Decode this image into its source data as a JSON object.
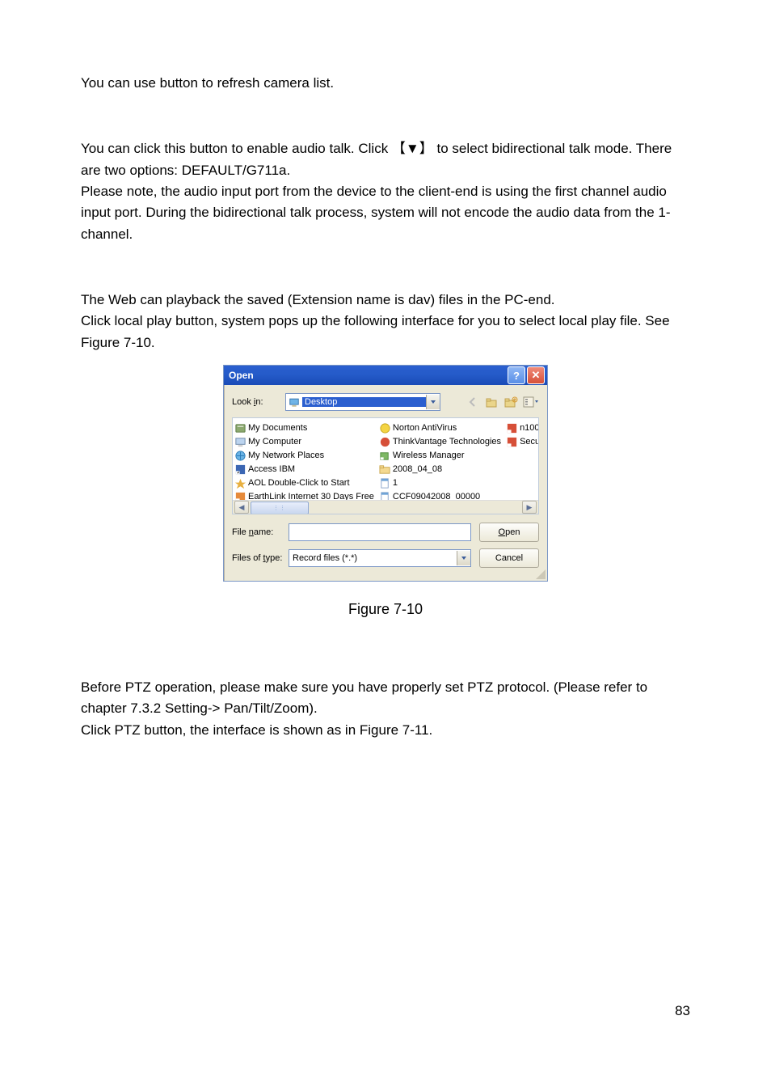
{
  "paragraphs": {
    "refresh": "You can use button to refresh camera list.",
    "audio1": "You can click this button to enable audio talk. Click 【▼】 to select bidirectional talk mode. There are two options: DEFAULT/G711a.",
    "audio2": "Please note, the audio input port from the device to the client-end is using the first channel audio input port. During the bidirectional talk process, system will not encode the audio data from the 1-channel.",
    "local1": "The Web can playback the saved (Extension name is dav) files in the PC-end.",
    "local2": "Click local play button, system pops up the following interface for you to select local play file. See Figure 7-10.",
    "ptz1": "Before PTZ operation, please make sure you have properly set PTZ protocol. (Please refer to chapter 7.3.2 Setting-> Pan/Tilt/Zoom).",
    "ptz2": "Click PTZ button, the interface is shown as in Figure 7-11."
  },
  "figure_caption": "Figure 7-10",
  "page_number": "83",
  "dialog": {
    "title": "Open",
    "lookin_label_pre": "Look ",
    "lookin_label_u": "i",
    "lookin_label_post": "n:",
    "lookin_value": "Desktop",
    "filename_label_pre": "File ",
    "filename_label_u": "n",
    "filename_label_post": "ame:",
    "filename_value": "",
    "type_label_pre": "Files of ",
    "type_label_u": "t",
    "type_label_post": "ype:",
    "type_value": "Record files (*.*)",
    "open_btn_u": "O",
    "open_btn_post": "pen",
    "cancel_btn": "Cancel",
    "col1": [
      "My Documents",
      "My Computer",
      "My Network Places",
      "Access IBM",
      "AOL Double-Click to Start",
      "EarthLink Internet 30 Days Free"
    ],
    "col2": [
      "Norton AntiVirus",
      "ThinkVantage Technologies",
      "Wireless Manager",
      "2008_04_08",
      "1",
      "CCF09042008_00000"
    ],
    "col3": [
      "n100",
      "Secu"
    ]
  }
}
